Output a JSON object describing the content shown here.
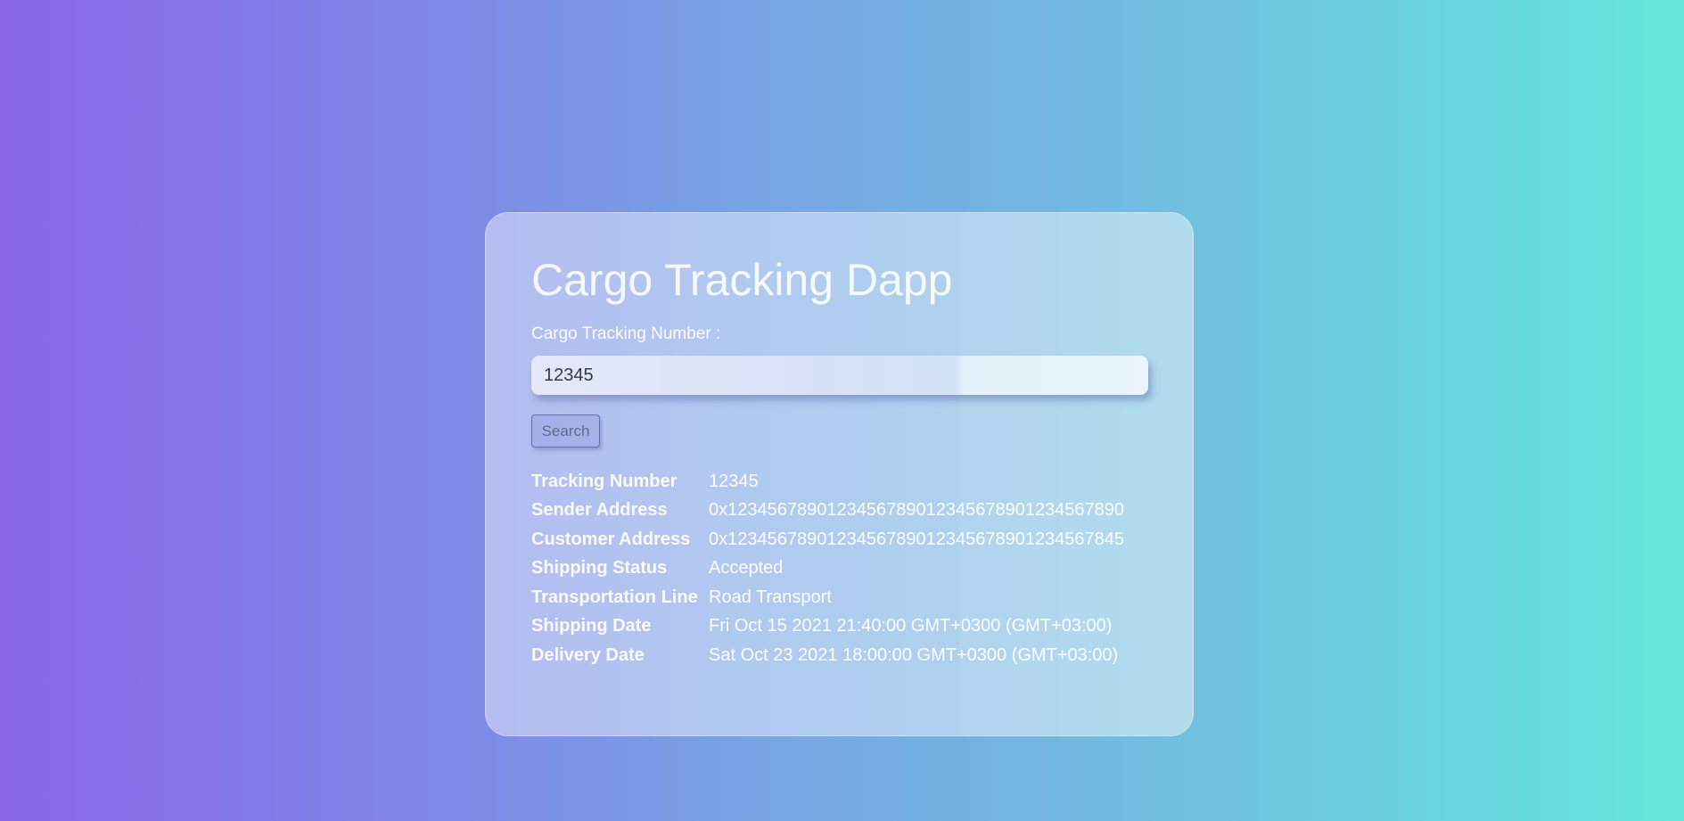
{
  "app": {
    "title": "Cargo Tracking Dapp"
  },
  "search": {
    "label": "Cargo Tracking Number :",
    "value": "12345",
    "button_label": "Search"
  },
  "details": [
    {
      "key": "Tracking Number",
      "value": "12345"
    },
    {
      "key": "Sender Address",
      "value": "0x1234567890123456789012345678901234567890"
    },
    {
      "key": "Customer Address",
      "value": "0x1234567890123456789012345678901234567845"
    },
    {
      "key": "Shipping Status",
      "value": "Accepted"
    },
    {
      "key": "Transportation Line",
      "value": "Road Transport"
    },
    {
      "key": "Shipping Date",
      "value": "Fri Oct 15 2021 21:40:00 GMT+0300 (GMT+03:00)"
    },
    {
      "key": "Delivery Date",
      "value": "Sat Oct 23 2021 18:00:00 GMT+0300 (GMT+03:00)"
    }
  ]
}
